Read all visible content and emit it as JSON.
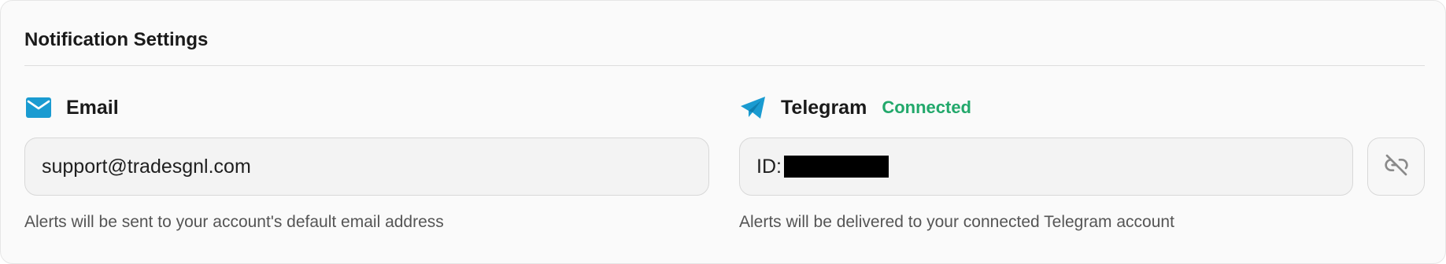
{
  "title": "Notification Settings",
  "email": {
    "icon": "mail-icon",
    "label": "Email",
    "value": "support@tradesgnl.com",
    "helper": "Alerts will be sent to your account's default email address"
  },
  "telegram": {
    "icon": "telegram-send-icon",
    "label": "Telegram",
    "status": "Connected",
    "id_prefix": "ID:",
    "helper": "Alerts will be delivered to your connected Telegram account",
    "unlink_icon": "unlink-icon"
  },
  "colors": {
    "accent": "#1a9bd1",
    "status_connected": "#22a86b",
    "unlink_icon": "#8a8a8a"
  }
}
